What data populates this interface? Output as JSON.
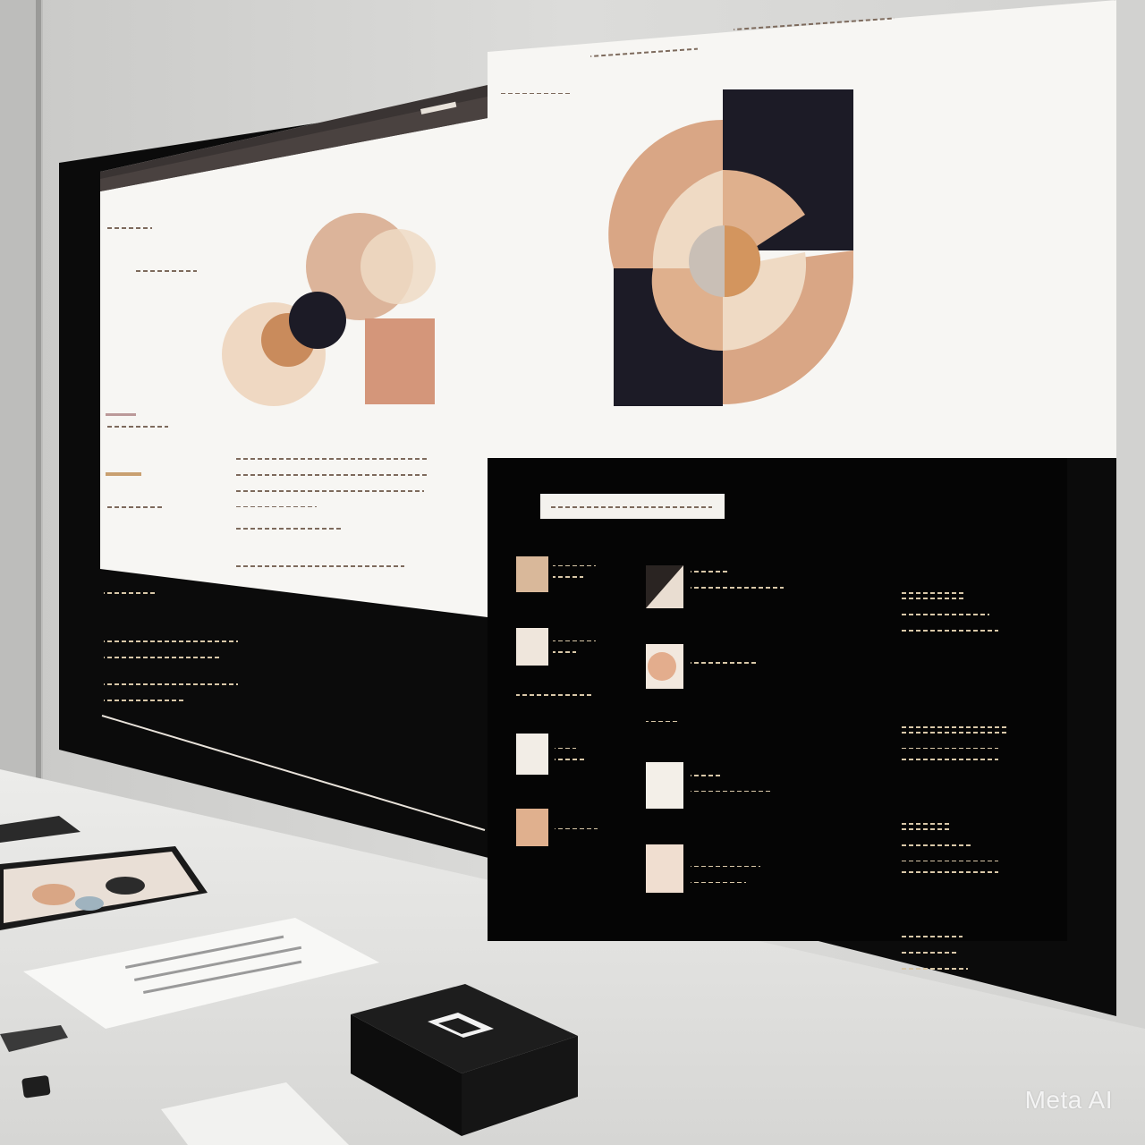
{
  "watermark": {
    "text": "Meta AI"
  },
  "palette": {
    "wall": "#d9d9d7",
    "desk": "#e4e4e2",
    "bezel": "#0b0b0b",
    "screen_white": "#f7f6f3",
    "tan": "#d9a685",
    "light_tan": "#e8c8ad",
    "cream": "#efdac4",
    "caramel": "#c98b5c",
    "navy": "#1c1b26",
    "grey_circle": "#c9bfb6"
  },
  "icons": [
    "scribble-text-lines",
    "swatch-thumbnail",
    "box-logo"
  ]
}
